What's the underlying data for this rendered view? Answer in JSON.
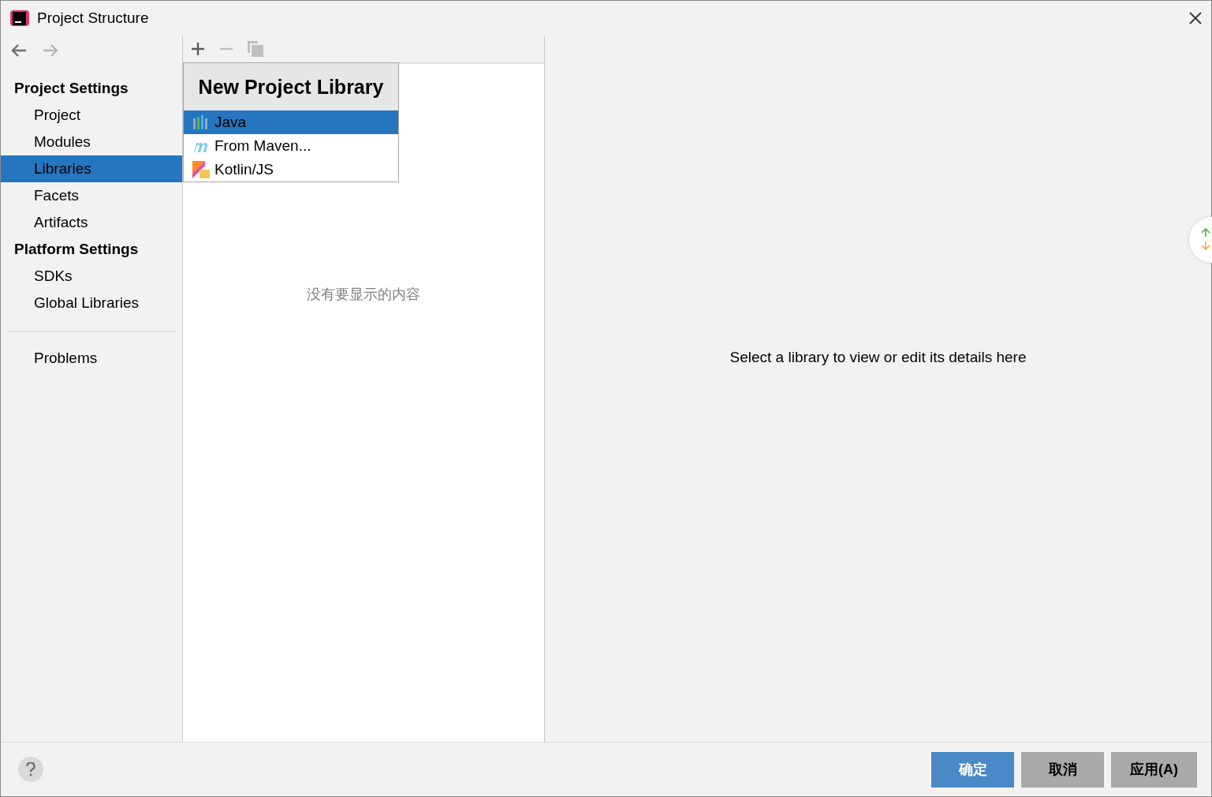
{
  "window": {
    "title": "Project Structure"
  },
  "nav": [
    {
      "kind": "back",
      "disabled": false
    },
    {
      "kind": "forward",
      "disabled": true
    }
  ],
  "sidebar": {
    "sections": [
      {
        "title": "Project Settings",
        "items": [
          {
            "label": "Project",
            "selected": false
          },
          {
            "label": "Modules",
            "selected": false
          },
          {
            "label": "Libraries",
            "selected": true
          },
          {
            "label": "Facets",
            "selected": false
          },
          {
            "label": "Artifacts",
            "selected": false
          }
        ]
      },
      {
        "title": "Platform Settings",
        "items": [
          {
            "label": "SDKs",
            "selected": false
          },
          {
            "label": "Global Libraries",
            "selected": false
          }
        ]
      }
    ],
    "bottom_items": [
      {
        "label": "Problems",
        "selected": false
      }
    ]
  },
  "toolbar": [
    {
      "kind": "add",
      "disabled": false
    },
    {
      "kind": "remove",
      "disabled": true
    },
    {
      "kind": "copy",
      "disabled": true
    }
  ],
  "list": {
    "empty_text": "没有要显示的内容"
  },
  "popup": {
    "title": "New Project Library",
    "items": [
      {
        "kind": "java",
        "label": "Java",
        "selected": true
      },
      {
        "kind": "maven",
        "label": "From Maven...",
        "selected": false
      },
      {
        "kind": "kotlin",
        "label": "Kotlin/JS",
        "selected": false
      }
    ]
  },
  "details": {
    "message": "Select a library to view or edit its details here"
  },
  "buttons": [
    {
      "label": "确定",
      "primary": true
    },
    {
      "label": "取消",
      "primary": false
    },
    {
      "label": "应用(A)",
      "primary": false
    }
  ]
}
